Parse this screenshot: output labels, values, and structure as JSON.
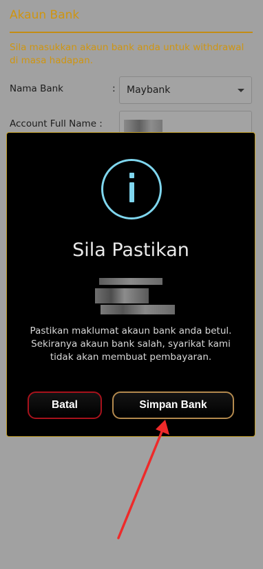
{
  "section": {
    "title": "Akaun Bank",
    "description": "Sila masukkan akaun bank anda untuk withdrawal di masa hadapan."
  },
  "form": {
    "bank_name_label": "Nama Bank",
    "account_name_label": "Account Full Name :",
    "colon": ":",
    "bank_name_value": "Maybank"
  },
  "modal": {
    "icon": "info-icon",
    "title": "Sila Pastikan",
    "message": "Pastikan maklumat akaun bank anda betul. Sekiranya akaun bank salah, syarikat kami tidak akan membuat pembayaran.",
    "cancel_label": "Batal",
    "save_label": "Simpan Bank"
  },
  "colors": {
    "accent_gold": "#cf9510",
    "modal_border": "#c5a12b",
    "info_blue": "#7fd6ee",
    "cancel_border": "#a8121c",
    "save_border": "#b48a4e",
    "annotation_arrow": "#ee2a2a"
  }
}
